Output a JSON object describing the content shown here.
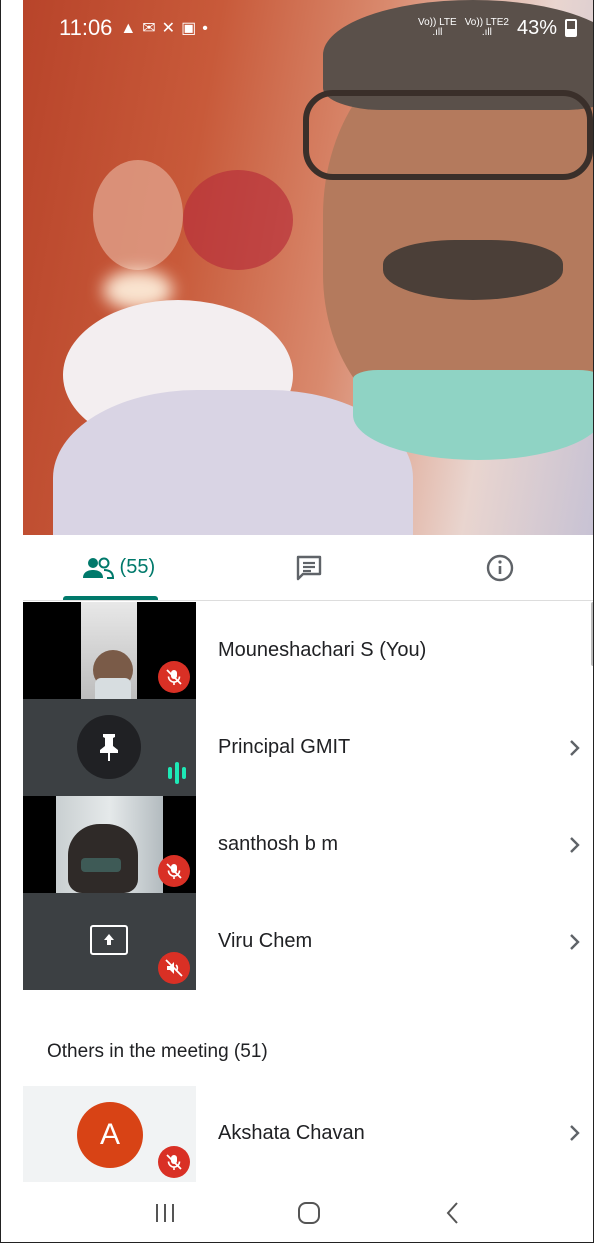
{
  "status_bar": {
    "time": "11:06",
    "network_left": "Vo)) LTE",
    "network_right": "Vo)) LTE2",
    "battery": "43%"
  },
  "tabs": {
    "people_count": "(55)",
    "active": "people"
  },
  "participants": [
    {
      "name": "Mouneshachari S (You)",
      "muted": true,
      "thumb": "camera",
      "has_chevron": false
    },
    {
      "name": "Principal GMIT",
      "muted": false,
      "thumb": "pinned",
      "has_chevron": true
    },
    {
      "name": "santhosh b m",
      "muted": true,
      "thumb": "camera",
      "has_chevron": true
    },
    {
      "name": "Viru Chem",
      "muted": true,
      "thumb": "presenting",
      "has_chevron": true
    }
  ],
  "others_section": {
    "title": "Others in the meeting (51)"
  },
  "others": [
    {
      "name": "Akshata Chavan",
      "initial": "A",
      "avatar_color": "#d84315",
      "muted": true
    }
  ],
  "colors": {
    "accent": "#00796b",
    "mute_red": "#d93025",
    "speaking_green": "#1de9b6"
  }
}
